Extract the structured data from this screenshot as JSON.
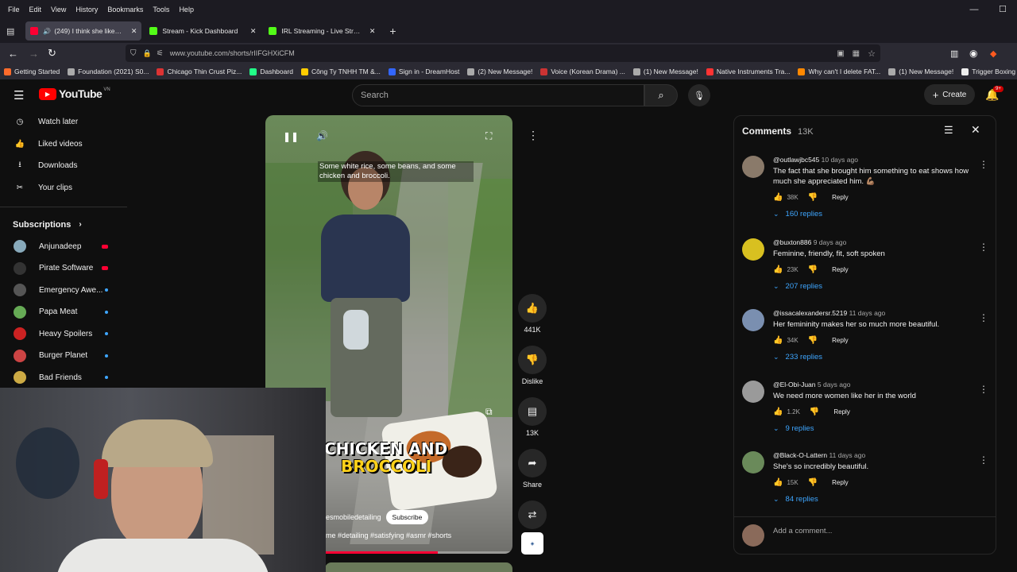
{
  "browser": {
    "menu": [
      "File",
      "Edit",
      "View",
      "History",
      "Bookmarks",
      "Tools",
      "Help"
    ],
    "tabs": [
      {
        "title": "(249) I think she likes me #...",
        "color": "#ff0033"
      },
      {
        "title": "Stream - Kick Dashboard",
        "color": "#53fc18"
      },
      {
        "title": "IRL Streaming - Live Streams on...",
        "color": "#53fc18"
      }
    ],
    "url": "www.youtube.com/shorts/rIIFGHXiCFM",
    "bookmarks": [
      {
        "label": "Getting Started",
        "color": "#ff6b2b"
      },
      {
        "label": "Foundation (2021) S0...",
        "color": "#aaaaaa"
      },
      {
        "label": "Chicago Thin Crust Piz...",
        "color": "#d33"
      },
      {
        "label": "Dashboard",
        "color": "#2f8"
      },
      {
        "label": "Công Ty TNHH TM &...",
        "color": "#fc0"
      },
      {
        "label": "Sign in - DreamHost",
        "color": "#36f"
      },
      {
        "label": "(2) New Message!",
        "color": "#aaa"
      },
      {
        "label": "Voice (Korean Drama) ...",
        "color": "#c33"
      },
      {
        "label": "(1) New Message!",
        "color": "#aaa"
      },
      {
        "label": "Native Instruments Tra...",
        "color": "#f33"
      },
      {
        "label": "Why can't I delete FAT...",
        "color": "#f80"
      },
      {
        "label": "(1) New Message!",
        "color": "#aaa"
      },
      {
        "label": "Trigger Boxing",
        "color": "#eee"
      }
    ]
  },
  "yt": {
    "logo": "YouTube",
    "region": "VN",
    "search_placeholder": "Search",
    "create": "Create",
    "notif": "9+",
    "sidebar": [
      {
        "label": "Watch later",
        "icon": "clock-icon"
      },
      {
        "label": "Liked videos",
        "icon": "thumb-up-icon"
      },
      {
        "label": "Downloads",
        "icon": "download-icon"
      },
      {
        "label": "Your clips",
        "icon": "scissors-icon"
      }
    ],
    "subs_title": "Subscriptions",
    "subs": [
      {
        "label": "Anjunadeep",
        "color": "#8ab",
        "live": true
      },
      {
        "label": "Pirate Software",
        "color": "#333",
        "live": true
      },
      {
        "label": "Emergency Awe...",
        "color": "#555",
        "live": false
      },
      {
        "label": "Papa Meat",
        "color": "#6a5",
        "live": false
      },
      {
        "label": "Heavy Spoilers",
        "color": "#c22",
        "live": false
      },
      {
        "label": "Burger Planet",
        "color": "#c44",
        "live": false
      },
      {
        "label": "Bad Friends",
        "color": "#ca4",
        "live": false
      }
    ],
    "video": {
      "caption": "Some white rice, some beans, and some chicken and broccoli.",
      "overlay_line1": "CHICKEN AND",
      "overlay_line2": "BROCCOLI",
      "channel": "esmobiledetailing",
      "subscribe": "Subscribe",
      "desc": "me #detailing #satisfying #asmr #shorts",
      "progress": 0.6
    },
    "actions": {
      "likes": "441K",
      "dislike": "Dislike",
      "comments": "13K",
      "share": "Share",
      "remix": "8"
    },
    "comments_panel": {
      "title": "Comments",
      "count": "13K",
      "add": "Add a comment...",
      "items": [
        {
          "author": "@outlawjbc545",
          "time": "10 days ago",
          "text": "The fact that she brought him something to eat shows how much she appreciated him. 💪🏽",
          "likes": "38K",
          "reply": "Reply",
          "replies": "160 replies",
          "color": "#8a7a6a"
        },
        {
          "author": "@buxton886",
          "time": "9 days ago",
          "text": "Feminine, friendly, fit, soft spoken",
          "likes": "23K",
          "reply": "Reply",
          "replies": "207 replies",
          "color": "#d8c020"
        },
        {
          "author": "@issacalexandersr.5219",
          "time": "11 days ago",
          "text": "Her femininity makes her so much more beautiful.",
          "likes": "34K",
          "reply": "Reply",
          "replies": "233 replies",
          "color": "#7a8fb0"
        },
        {
          "author": "@El-Obi-Juan",
          "time": "5 days ago",
          "text": "We need more women like her in the world",
          "likes": "1.2K",
          "reply": "Reply",
          "replies": "9 replies",
          "color": "#9a9a9a"
        },
        {
          "author": "@Black-O-Lattern",
          "time": "11 days ago",
          "text": "She's so incredibly beautiful.",
          "likes": "15K",
          "reply": "Reply",
          "replies": "84 replies",
          "color": "#6a8a5a"
        }
      ]
    }
  }
}
